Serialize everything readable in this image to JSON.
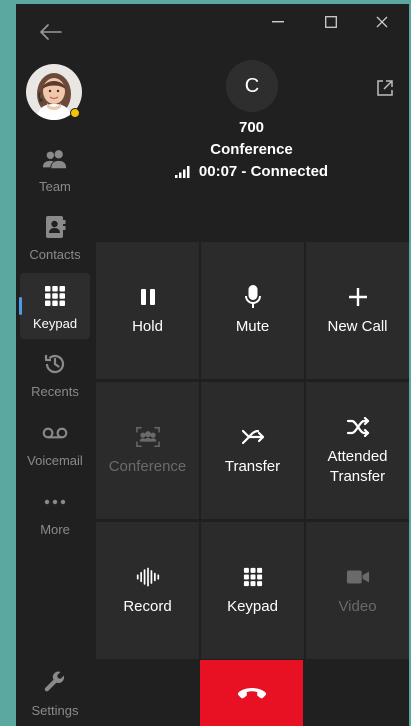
{
  "sidebar": {
    "items": [
      {
        "label": "Team",
        "icon": "team-icon"
      },
      {
        "label": "Contacts",
        "icon": "contacts-icon"
      },
      {
        "label": "Keypad",
        "icon": "keypad-icon",
        "active": true
      },
      {
        "label": "Recents",
        "icon": "recents-icon"
      },
      {
        "label": "Voicemail",
        "icon": "voicemail-icon"
      },
      {
        "label": "More",
        "icon": "more-icon"
      }
    ],
    "settings_label": "Settings"
  },
  "call": {
    "initial": "C",
    "number": "700",
    "name": "Conference",
    "status": "00:07 - Connected"
  },
  "controls": [
    {
      "label": "Hold",
      "icon": "pause-icon",
      "enabled": true
    },
    {
      "label": "Mute",
      "icon": "microphone-icon",
      "enabled": true
    },
    {
      "label": "New Call",
      "icon": "plus-icon",
      "enabled": true
    },
    {
      "label": "Conference",
      "icon": "conference-icon",
      "enabled": false
    },
    {
      "label": "Transfer",
      "icon": "transfer-icon",
      "enabled": true
    },
    {
      "label": "Attended Transfer",
      "icon": "attended-transfer-icon",
      "enabled": true
    },
    {
      "label": "Record",
      "icon": "record-icon",
      "enabled": true
    },
    {
      "label": "Keypad",
      "icon": "keypad-icon",
      "enabled": true
    },
    {
      "label": "Video",
      "icon": "video-icon",
      "enabled": false
    }
  ],
  "colors": {
    "background": "#1f1f1f",
    "cell": "#2b2b2b",
    "hangup": "#e81123",
    "accent": "#4c9be8",
    "presence": "#f4c400"
  }
}
